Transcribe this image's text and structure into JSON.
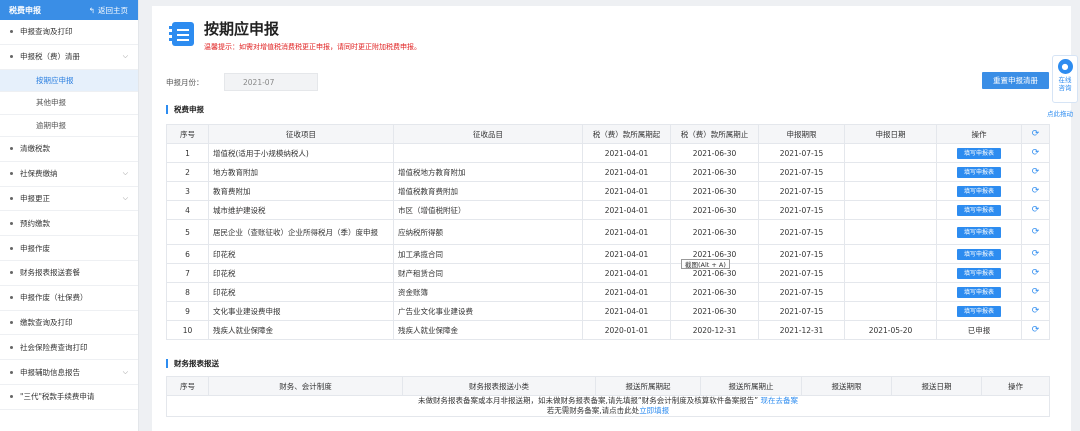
{
  "sidebar": {
    "header_title": "税费申报",
    "back_label": "返回主页",
    "items": [
      {
        "label": "申报查询及打印",
        "chev": false
      },
      {
        "label": "申报税（费）清册",
        "chev": true
      },
      {
        "label": "清缴税款",
        "chev": false
      },
      {
        "label": "社保费缴纳",
        "chev": true
      },
      {
        "label": "申报更正",
        "chev": true
      },
      {
        "label": "预约缴款",
        "chev": false
      },
      {
        "label": "申报作废",
        "chev": false
      },
      {
        "label": "财务报表报送套餐",
        "chev": false
      },
      {
        "label": "申报作废（社保费）",
        "chev": false
      },
      {
        "label": "缴款查询及打印",
        "chev": false
      },
      {
        "label": "社会保险费查询打印",
        "chev": false
      },
      {
        "label": "申报辅助信息报告",
        "chev": true
      },
      {
        "label": "\"三代\"税款手续费申请",
        "chev": false
      }
    ],
    "sub_items": [
      "按期应申报",
      "其他申报",
      "逾期申报"
    ]
  },
  "page": {
    "title": "按期应申报",
    "tip": "温馨提示：如需对增值税消费税更正申报，请同时更正附加税费申报。",
    "period_label": "申报月份：",
    "period_value": "2021-07",
    "reset_button": "重置申报清册"
  },
  "tax_section": {
    "title": "税费申报",
    "headers": [
      "序号",
      "征收项目",
      "征收品目",
      "税（费）款所属期起",
      "税（费）款所属期止",
      "申报期限",
      "申报日期",
      "操作"
    ],
    "rows": [
      [
        "1",
        "增值税(适用于小规模纳税人)",
        "",
        "2021-04-01",
        "2021-06-30",
        "2021-07-15",
        "",
        "填写申报表"
      ],
      [
        "2",
        "地方教育附加",
        "增值税地方教育附加",
        "2021-04-01",
        "2021-06-30",
        "2021-07-15",
        "",
        "填写申报表"
      ],
      [
        "3",
        "教育费附加",
        "增值税教育费附加",
        "2021-04-01",
        "2021-06-30",
        "2021-07-15",
        "",
        "填写申报表"
      ],
      [
        "4",
        "城市维护建设税",
        "市区（增值税附征）",
        "2021-04-01",
        "2021-06-30",
        "2021-07-15",
        "",
        "填写申报表"
      ],
      [
        "5",
        "居民企业（查账征收）企业所得税月（季）度申报",
        "应纳税所得额",
        "2021-04-01",
        "2021-06-30",
        "2021-07-15",
        "",
        "填写申报表"
      ],
      [
        "6",
        "印花税",
        "加工承揽合同",
        "2021-04-01",
        "2021-06-30",
        "2021-07-15",
        "",
        "填写申报表"
      ],
      [
        "7",
        "印花税",
        "财产租赁合同",
        "2021-04-01",
        "2021-06-30",
        "2021-07-15",
        "",
        "填写申报表"
      ],
      [
        "8",
        "印花税",
        "资金账簿",
        "2021-04-01",
        "2021-06-30",
        "2021-07-15",
        "",
        "填写申报表"
      ],
      [
        "9",
        "文化事业建设费申报",
        "广告业文化事业建设费",
        "2021-04-01",
        "2021-06-30",
        "2021-07-15",
        "",
        "填写申报表"
      ],
      [
        "10",
        "残疾人就业保障金",
        "残疾人就业保障金",
        "2020-01-01",
        "2020-12-31",
        "2021-12-31",
        "2021-05-20",
        "已申报"
      ]
    ]
  },
  "report_section": {
    "title": "财务报表报送",
    "headers": [
      "序号",
      "财务、会计制度",
      "财务报表报送小类",
      "报送所属期起",
      "报送所属期止",
      "报送期限",
      "报送日期",
      "操作"
    ],
    "note_line1": "未做财务报表备案或本月非报送期，如未做财务报表备案,请先填报“财务会计制度及核算软件备案报告”",
    "note_link1": "现在去备案",
    "note_line2": "若无需财务备案,请点击此处",
    "note_link2": "立即填报"
  },
  "screenshot_tip": "截图(Alt + A)",
  "consult": {
    "label_line1": "在线",
    "label_line2": "咨询",
    "drag_hint": "点此拖动"
  },
  "colors": {
    "accent": "#2d8cf0",
    "warning": "#e02020"
  }
}
